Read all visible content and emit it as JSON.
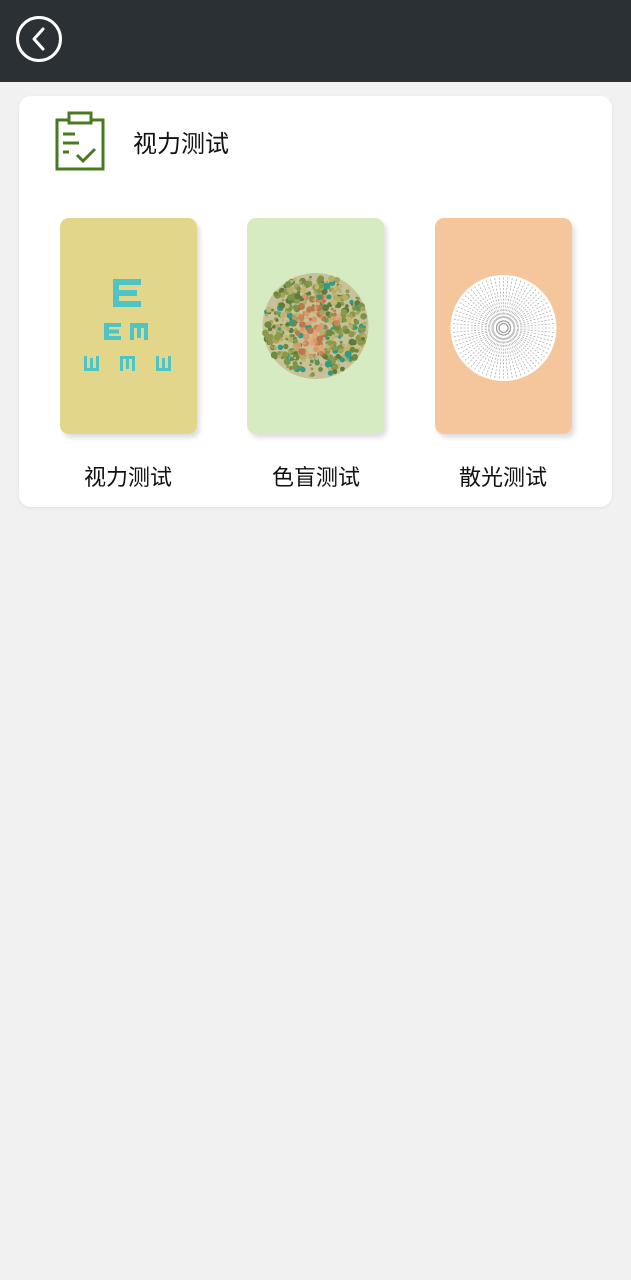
{
  "colors": {
    "topbar": "#2a3034",
    "header_icon": "#4a7a1f",
    "optotype": "#4ec4c4"
  },
  "nav": {
    "back_icon": "chevron-left-icon"
  },
  "card": {
    "icon": "clipboard-check-icon",
    "title": "视力测试"
  },
  "tests": [
    {
      "id": "vision",
      "label": "视力测试",
      "color": "#e2d68a",
      "icon": "eye-chart-icon"
    },
    {
      "id": "color-blind",
      "label": "色盲测试",
      "color": "#d7ebc3",
      "icon": "ishihara-plate-icon"
    },
    {
      "id": "astigmatism",
      "label": "散光测试",
      "color": "#f5c59c",
      "icon": "astigmatism-dial-icon"
    }
  ]
}
